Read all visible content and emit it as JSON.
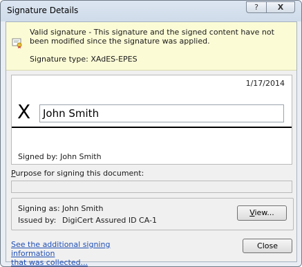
{
  "window": {
    "title": "Signature Details",
    "help_label": "?",
    "close_label": "X"
  },
  "infobar": {
    "message": "Valid signature - This signature and the signed content have not been modified since the signature was applied.",
    "signature_type": "Signature type: XAdES-EPES"
  },
  "signature": {
    "date": "1/17/2014",
    "x_mark": "X",
    "name": "John Smith",
    "signed_by": "Signed by: John Smith"
  },
  "purpose": {
    "label_accesskey": "P",
    "label_rest": "urpose for signing this document:",
    "value": ""
  },
  "signer": {
    "signing_as_label": "Signing as:",
    "signing_as_value": "John Smith",
    "issued_by_label": "Issued by:",
    "issued_by_value": "DigiCert Assured ID CA-1",
    "view_accesskey": "V",
    "view_rest": "iew..."
  },
  "footer": {
    "link_line1": "See the additional signing information",
    "link_line2": "that was collected...",
    "close_button": "Close"
  },
  "colors": {
    "infobar_bg": "#fbfbd6",
    "link": "#1f4fb5",
    "titlebar": "#dce6f2"
  },
  "icons": {
    "infobar_icon": "certificate-icon"
  }
}
